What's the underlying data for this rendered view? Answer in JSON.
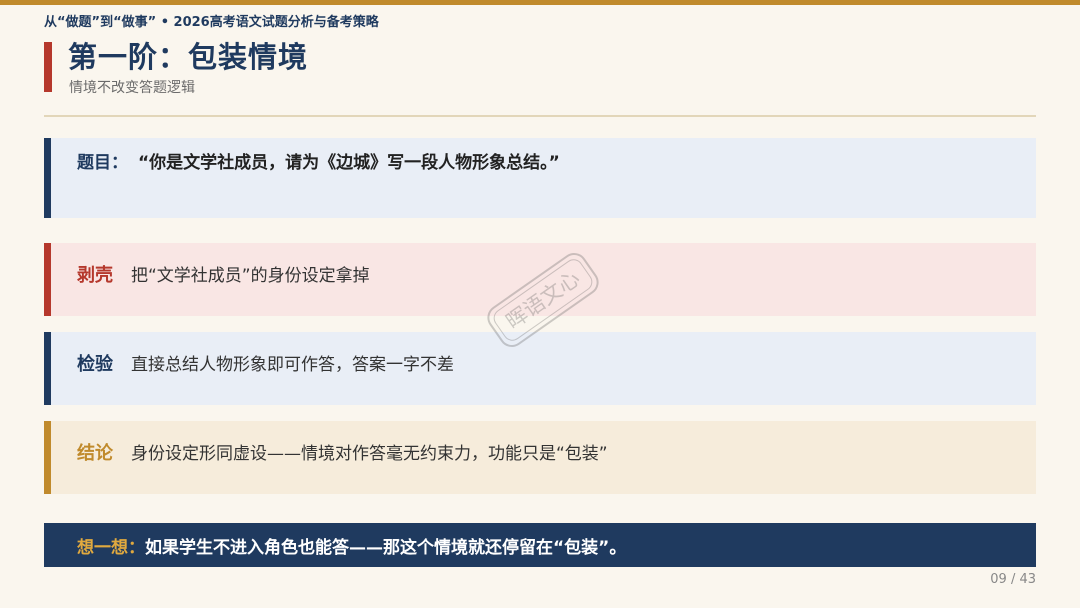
{
  "header": {
    "breadcrumb": "从“做题”到“做事” • 2026高考语文试题分析与备考策略",
    "title": "第一阶：包装情境",
    "subtitle": "情境不改变答题逻辑"
  },
  "question": {
    "label": "题目：",
    "text": "“你是文学社成员，请为《边城》写一段人物形象总结。”"
  },
  "rows": [
    {
      "label": "剥壳",
      "text": "把“文学社成员”的身份设定拿掉"
    },
    {
      "label": "检验",
      "text": "直接总结人物形象即可作答，答案一字不差"
    },
    {
      "label": "结论",
      "text": "身份设定形同虚设——情境对作答毫无约束力，功能只是“包装”"
    }
  ],
  "think": {
    "label": "想一想：",
    "text": "如果学生不进入角色也能答——那这个情境就还停留在“包装”。"
  },
  "watermark": "晖语文心",
  "page": "09 / 43",
  "colors": {
    "navy": "#1f3a5f",
    "red": "#b5382c",
    "gold": "#c08a2c",
    "background": "#faf6ee"
  }
}
